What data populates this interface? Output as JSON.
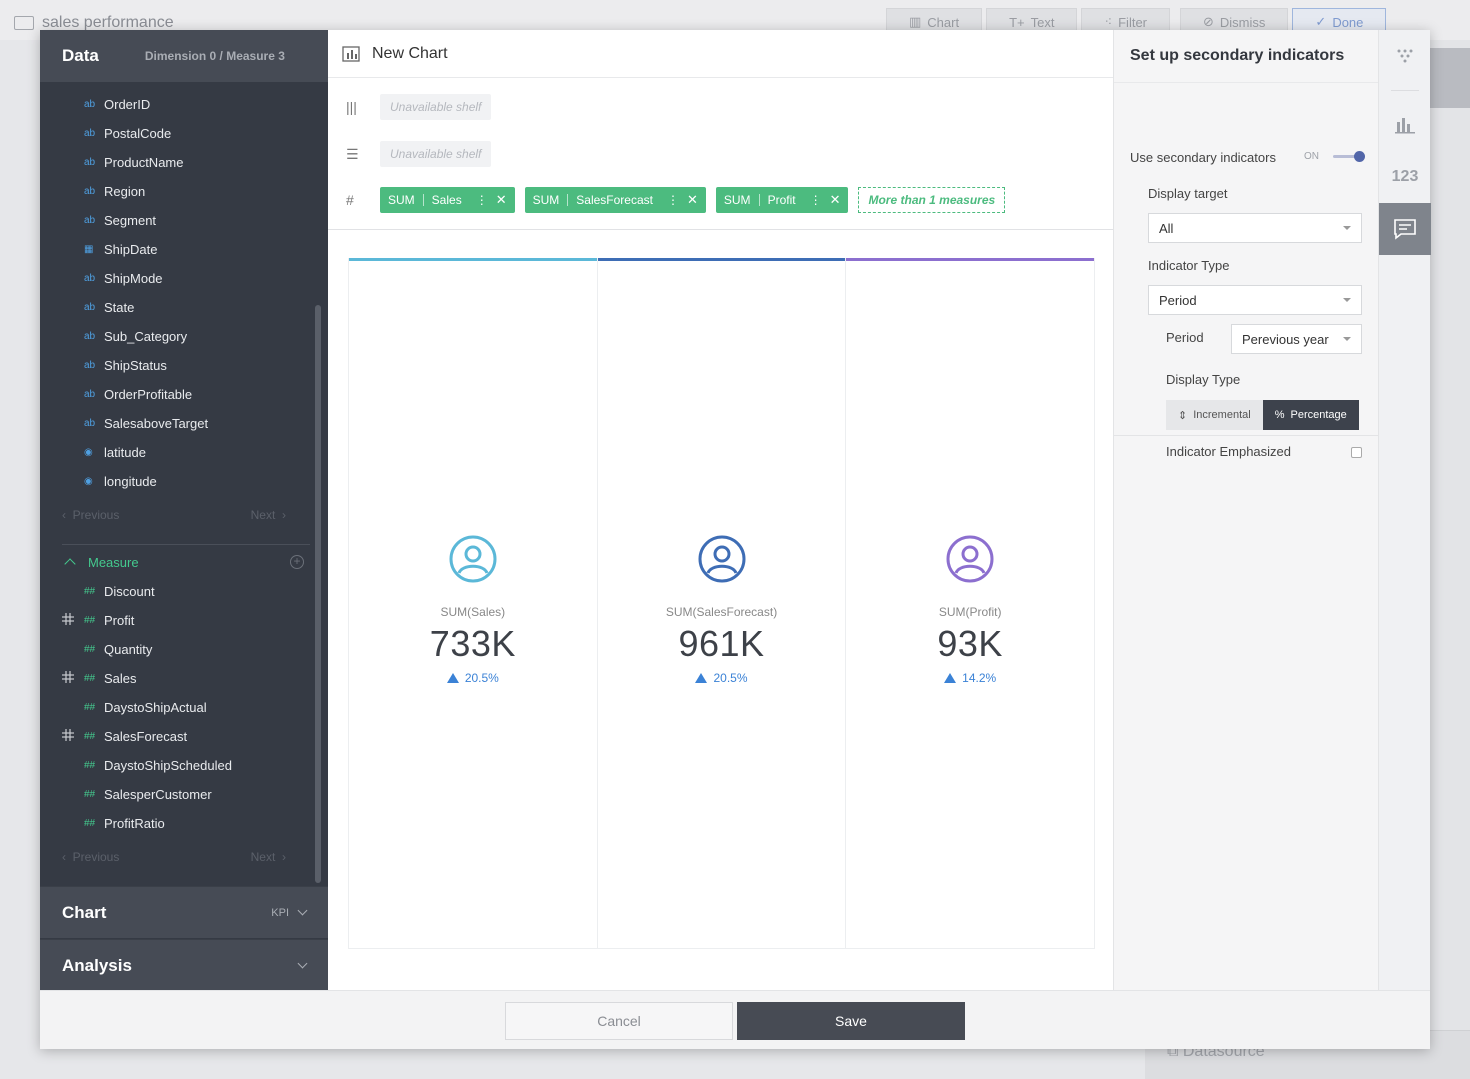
{
  "app": {
    "doc_title": "sales performance",
    "toolbar": {
      "chart": "Chart",
      "text": "Text",
      "filter": "Filter",
      "dismiss": "Dismiss",
      "done": "Done"
    },
    "datasource_label": "Datasource"
  },
  "data_panel": {
    "title": "Data",
    "summary": "Dimension 0 / Measure 3",
    "dimensions": [
      {
        "label": "OrderID",
        "icon": "ab"
      },
      {
        "label": "PostalCode",
        "icon": "ab"
      },
      {
        "label": "ProductName",
        "icon": "ab"
      },
      {
        "label": "Region",
        "icon": "ab"
      },
      {
        "label": "Segment",
        "icon": "ab"
      },
      {
        "label": "ShipDate",
        "icon": "calendar"
      },
      {
        "label": "ShipMode",
        "icon": "ab"
      },
      {
        "label": "State",
        "icon": "ab"
      },
      {
        "label": "Sub_Category",
        "icon": "ab"
      },
      {
        "label": "ShipStatus",
        "icon": "ab"
      },
      {
        "label": "OrderProfitable",
        "icon": "ab"
      },
      {
        "label": "SalesaboveTarget",
        "icon": "ab"
      },
      {
        "label": "latitude",
        "icon": "location"
      },
      {
        "label": "longitude",
        "icon": "location"
      }
    ],
    "pager": {
      "previous": "Previous",
      "next": "Next"
    },
    "measure_header": "Measure",
    "measures": [
      {
        "label": "Discount",
        "in_use": false
      },
      {
        "label": "Profit",
        "in_use": true
      },
      {
        "label": "Quantity",
        "in_use": false
      },
      {
        "label": "Sales",
        "in_use": true
      },
      {
        "label": "DaystoShipActual",
        "in_use": false
      },
      {
        "label": "SalesForecast",
        "in_use": true
      },
      {
        "label": "DaystoShipScheduled",
        "in_use": false
      },
      {
        "label": "SalesperCustomer",
        "in_use": false
      },
      {
        "label": "ProfitRatio",
        "in_use": false
      }
    ],
    "chart_section": {
      "title": "Chart",
      "value": "KPI"
    },
    "analysis_section": {
      "title": "Analysis"
    }
  },
  "chart_area": {
    "title": "New Chart",
    "column_shelf": "Unavailable shelf",
    "row_shelf": "Unavailable shelf",
    "measure_pills": [
      {
        "agg": "SUM",
        "field": "Sales"
      },
      {
        "agg": "SUM",
        "field": "SalesForecast"
      },
      {
        "agg": "SUM",
        "field": "Profit"
      }
    ],
    "more_label": "More than 1 measures",
    "kpis": [
      {
        "label": "SUM(Sales)",
        "value": "733K",
        "delta": "20.5%",
        "color": "#5bb8d8"
      },
      {
        "label": "SUM(SalesForecast)",
        "value": "961K",
        "delta": "20.5%",
        "color": "#3e6db5"
      },
      {
        "label": "SUM(Profit)",
        "value": "93K",
        "delta": "14.2%",
        "color": "#8c6fcf"
      }
    ]
  },
  "settings": {
    "title": "Set up secondary indicators",
    "use_label": "Use secondary indicators",
    "toggle_state": "ON",
    "display_target_label": "Display target",
    "display_target_value": "All",
    "indicator_type_label": "Indicator Type",
    "indicator_type_value": "Period",
    "period_label": "Period",
    "period_value": "Perevious year",
    "display_type_label": "Display Type",
    "display_type_options": [
      "Incremental",
      "Percentage"
    ],
    "display_type_selected": "Percentage",
    "emphasized_label": "Indicator Emphasized"
  },
  "rail": {
    "number_icon_text": "123"
  },
  "footer": {
    "cancel": "Cancel",
    "save": "Save"
  }
}
